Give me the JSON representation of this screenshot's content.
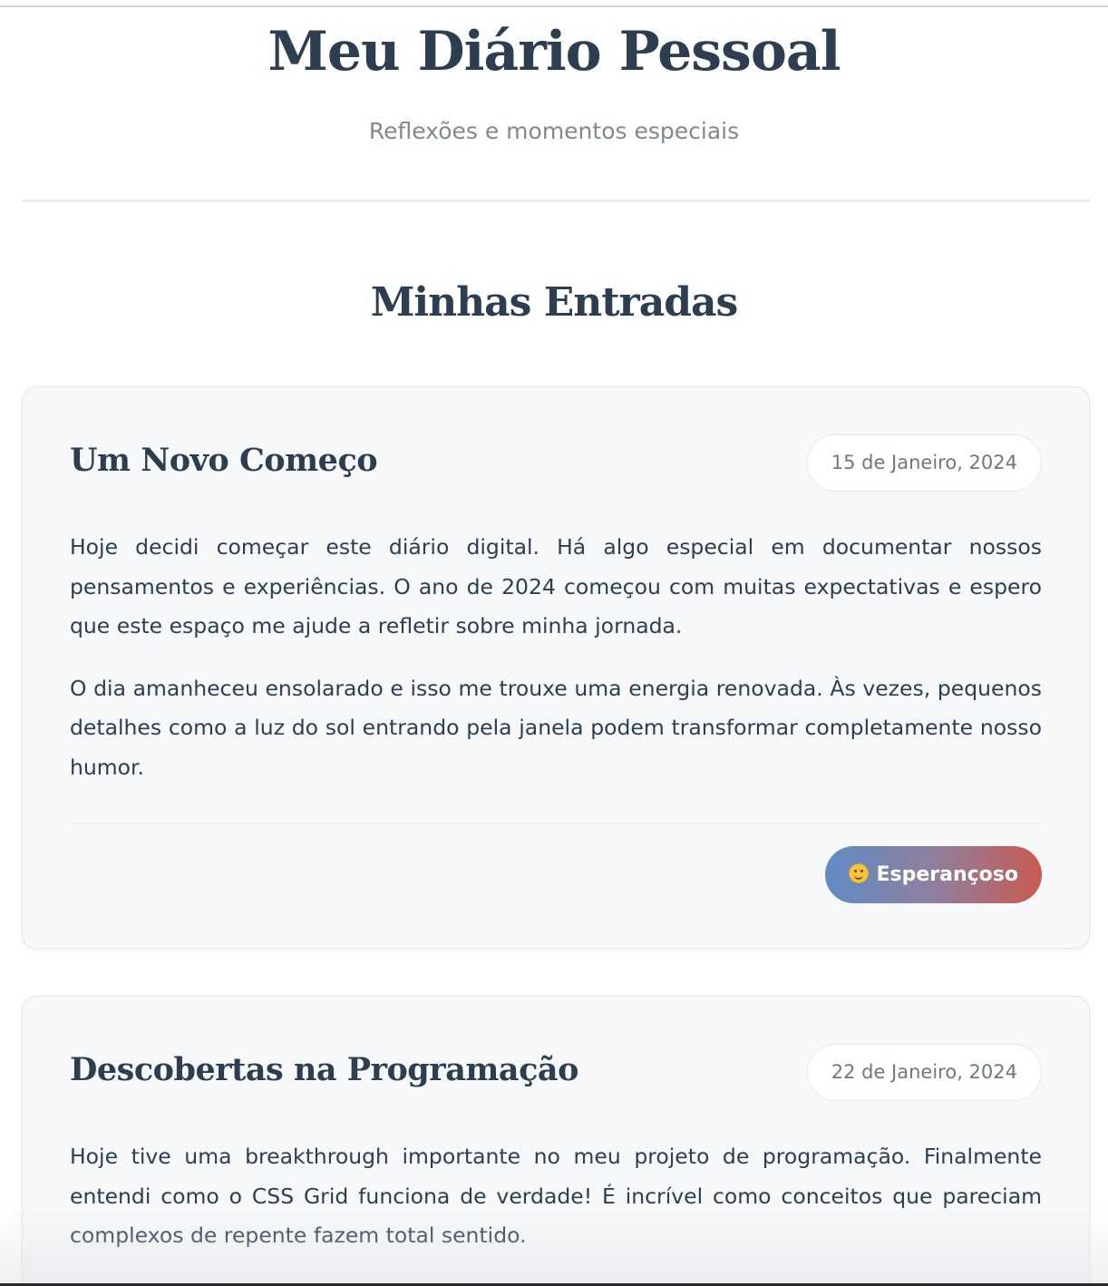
{
  "header": {
    "title": "Meu Diário Pessoal",
    "subtitle": "Reflexões e momentos especiais"
  },
  "section": {
    "title": "Minhas Entradas"
  },
  "entries": [
    {
      "title": "Um Novo Começo",
      "date": "15 de Janeiro, 2024",
      "paragraphs": [
        "Hoje decidi começar este diário digital. Há algo especial em documentar nossos pensamentos e experiências. O ano de 2024 começou com muitas expectativas e espero que este espaço me ajude a refletir sobre minha jornada.",
        "O dia amanheceu ensolarado e isso me trouxe uma energia renovada. Às vezes, pequenos detalhes como a luz do sol entrando pela janela podem transformar completamente nosso humor."
      ],
      "mood": {
        "label": "Esperançoso",
        "icon": "smiling-face-icon"
      }
    },
    {
      "title": "Descobertas na Programação",
      "date": "22 de Janeiro, 2024",
      "paragraphs": [
        "Hoje tive uma breakthrough importante no meu projeto de programação. Finalmente entendi como o CSS Grid funciona de verdade! É incrível como conceitos que pareciam complexos de repente fazem total sentido."
      ]
    }
  ],
  "colors": {
    "text": "#2c3e50",
    "muted": "#808890",
    "card_bg": "#f7f8fa",
    "mood_gradient_start": "#5f8bc5",
    "mood_gradient_end": "#c95b52"
  }
}
